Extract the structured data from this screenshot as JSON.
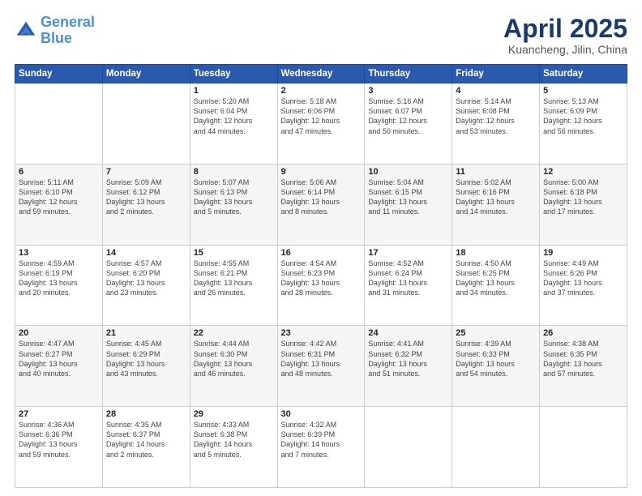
{
  "header": {
    "logo_line1": "General",
    "logo_line2": "Blue",
    "month": "April 2025",
    "location": "Kuancheng, Jilin, China"
  },
  "days_of_week": [
    "Sunday",
    "Monday",
    "Tuesday",
    "Wednesday",
    "Thursday",
    "Friday",
    "Saturday"
  ],
  "weeks": [
    [
      {
        "day": "",
        "info": ""
      },
      {
        "day": "",
        "info": ""
      },
      {
        "day": "1",
        "info": "Sunrise: 5:20 AM\nSunset: 6:04 PM\nDaylight: 12 hours\nand 44 minutes."
      },
      {
        "day": "2",
        "info": "Sunrise: 5:18 AM\nSunset: 6:06 PM\nDaylight: 12 hours\nand 47 minutes."
      },
      {
        "day": "3",
        "info": "Sunrise: 5:16 AM\nSunset: 6:07 PM\nDaylight: 12 hours\nand 50 minutes."
      },
      {
        "day": "4",
        "info": "Sunrise: 5:14 AM\nSunset: 6:08 PM\nDaylight: 12 hours\nand 53 minutes."
      },
      {
        "day": "5",
        "info": "Sunrise: 5:13 AM\nSunset: 6:09 PM\nDaylight: 12 hours\nand 56 minutes."
      }
    ],
    [
      {
        "day": "6",
        "info": "Sunrise: 5:11 AM\nSunset: 6:10 PM\nDaylight: 12 hours\nand 59 minutes."
      },
      {
        "day": "7",
        "info": "Sunrise: 5:09 AM\nSunset: 6:12 PM\nDaylight: 13 hours\nand 2 minutes."
      },
      {
        "day": "8",
        "info": "Sunrise: 5:07 AM\nSunset: 6:13 PM\nDaylight: 13 hours\nand 5 minutes."
      },
      {
        "day": "9",
        "info": "Sunrise: 5:06 AM\nSunset: 6:14 PM\nDaylight: 13 hours\nand 8 minutes."
      },
      {
        "day": "10",
        "info": "Sunrise: 5:04 AM\nSunset: 6:15 PM\nDaylight: 13 hours\nand 11 minutes."
      },
      {
        "day": "11",
        "info": "Sunrise: 5:02 AM\nSunset: 6:16 PM\nDaylight: 13 hours\nand 14 minutes."
      },
      {
        "day": "12",
        "info": "Sunrise: 5:00 AM\nSunset: 6:18 PM\nDaylight: 13 hours\nand 17 minutes."
      }
    ],
    [
      {
        "day": "13",
        "info": "Sunrise: 4:59 AM\nSunset: 6:19 PM\nDaylight: 13 hours\nand 20 minutes."
      },
      {
        "day": "14",
        "info": "Sunrise: 4:57 AM\nSunset: 6:20 PM\nDaylight: 13 hours\nand 23 minutes."
      },
      {
        "day": "15",
        "info": "Sunrise: 4:55 AM\nSunset: 6:21 PM\nDaylight: 13 hours\nand 26 minutes."
      },
      {
        "day": "16",
        "info": "Sunrise: 4:54 AM\nSunset: 6:23 PM\nDaylight: 13 hours\nand 28 minutes."
      },
      {
        "day": "17",
        "info": "Sunrise: 4:52 AM\nSunset: 6:24 PM\nDaylight: 13 hours\nand 31 minutes."
      },
      {
        "day": "18",
        "info": "Sunrise: 4:50 AM\nSunset: 6:25 PM\nDaylight: 13 hours\nand 34 minutes."
      },
      {
        "day": "19",
        "info": "Sunrise: 4:49 AM\nSunset: 6:26 PM\nDaylight: 13 hours\nand 37 minutes."
      }
    ],
    [
      {
        "day": "20",
        "info": "Sunrise: 4:47 AM\nSunset: 6:27 PM\nDaylight: 13 hours\nand 40 minutes."
      },
      {
        "day": "21",
        "info": "Sunrise: 4:45 AM\nSunset: 6:29 PM\nDaylight: 13 hours\nand 43 minutes."
      },
      {
        "day": "22",
        "info": "Sunrise: 4:44 AM\nSunset: 6:30 PM\nDaylight: 13 hours\nand 46 minutes."
      },
      {
        "day": "23",
        "info": "Sunrise: 4:42 AM\nSunset: 6:31 PM\nDaylight: 13 hours\nand 48 minutes."
      },
      {
        "day": "24",
        "info": "Sunrise: 4:41 AM\nSunset: 6:32 PM\nDaylight: 13 hours\nand 51 minutes."
      },
      {
        "day": "25",
        "info": "Sunrise: 4:39 AM\nSunset: 6:33 PM\nDaylight: 13 hours\nand 54 minutes."
      },
      {
        "day": "26",
        "info": "Sunrise: 4:38 AM\nSunset: 6:35 PM\nDaylight: 13 hours\nand 57 minutes."
      }
    ],
    [
      {
        "day": "27",
        "info": "Sunrise: 4:36 AM\nSunset: 6:36 PM\nDaylight: 13 hours\nand 59 minutes."
      },
      {
        "day": "28",
        "info": "Sunrise: 4:35 AM\nSunset: 6:37 PM\nDaylight: 14 hours\nand 2 minutes."
      },
      {
        "day": "29",
        "info": "Sunrise: 4:33 AM\nSunset: 6:38 PM\nDaylight: 14 hours\nand 5 minutes."
      },
      {
        "day": "30",
        "info": "Sunrise: 4:32 AM\nSunset: 6:39 PM\nDaylight: 14 hours\nand 7 minutes."
      },
      {
        "day": "",
        "info": ""
      },
      {
        "day": "",
        "info": ""
      },
      {
        "day": "",
        "info": ""
      }
    ]
  ]
}
